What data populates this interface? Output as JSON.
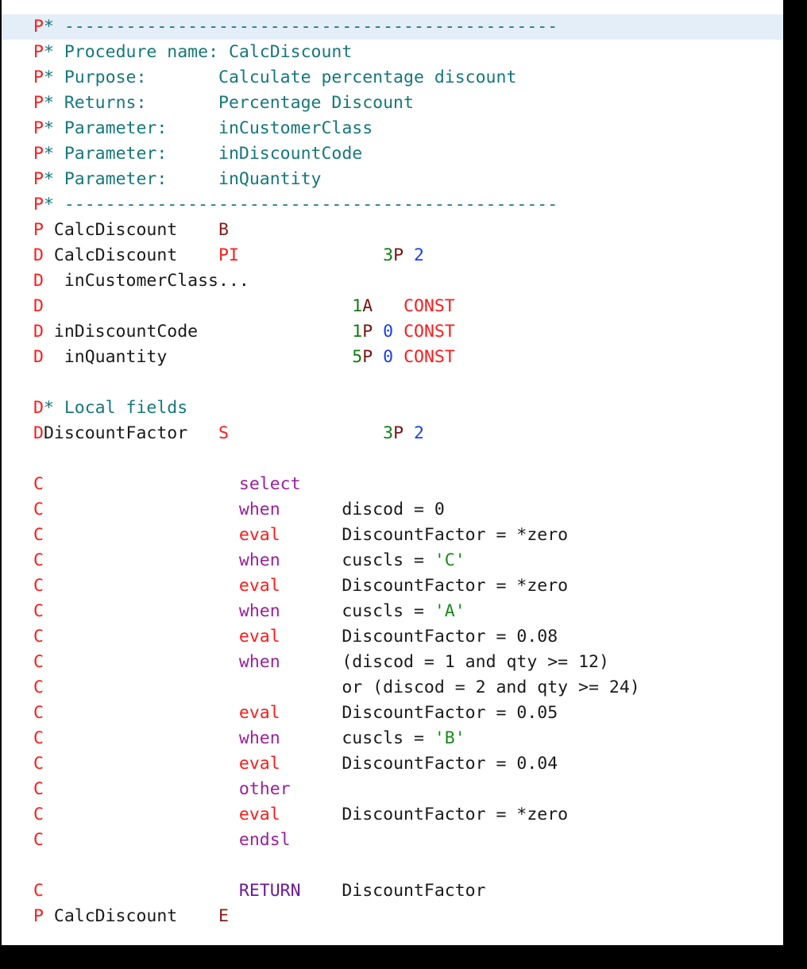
{
  "editor": {
    "language": "RPG IV / ILE RPG",
    "current_line_index": 0,
    "background_color": "#ffffff",
    "current_line_color": "#e4eef9",
    "frame_color": "#000000",
    "colors": {
      "spec_letter": "#ff1a1a",
      "spec_letter_dark": "#8b1a1a",
      "comment": "#15777b",
      "identifier": "#1a1a1a",
      "keyword_red": "#ff1a1a",
      "keyword_purple": "#9b1f9b",
      "keyword_return": "#6a1b9a",
      "length": "#127a12",
      "datatype": "#7a1414",
      "decimals": "#1a3ef0",
      "literal": "#1a8a1a"
    }
  },
  "source": {
    "procedure_name": "CalcDiscount",
    "lines": [
      {
        "id": "l01",
        "current": true,
        "tokens": [
          {
            "text": "P*",
            "cls": "t-spec-star"
          },
          {
            "text": " ------------------------------------------------",
            "cls": "t-comment"
          }
        ]
      },
      {
        "id": "l02",
        "tokens": [
          {
            "text": "P*",
            "cls": "t-spec-star"
          },
          {
            "text": " Procedure name: CalcDiscount",
            "cls": "t-comment"
          }
        ]
      },
      {
        "id": "l03",
        "tokens": [
          {
            "text": "P*",
            "cls": "t-spec-star"
          },
          {
            "text": " Purpose:       Calculate percentage discount",
            "cls": "t-comment"
          }
        ]
      },
      {
        "id": "l04",
        "tokens": [
          {
            "text": "P*",
            "cls": "t-spec-star"
          },
          {
            "text": " Returns:       Percentage Discount",
            "cls": "t-comment"
          }
        ]
      },
      {
        "id": "l05",
        "tokens": [
          {
            "text": "P*",
            "cls": "t-spec-star"
          },
          {
            "text": " Parameter:     inCustomerClass",
            "cls": "t-comment"
          }
        ]
      },
      {
        "id": "l06",
        "tokens": [
          {
            "text": "P*",
            "cls": "t-spec-star"
          },
          {
            "text": " Parameter:     inDiscountCode",
            "cls": "t-comment"
          }
        ]
      },
      {
        "id": "l07",
        "tokens": [
          {
            "text": "P*",
            "cls": "t-spec-star"
          },
          {
            "text": " Parameter:     inQuantity",
            "cls": "t-comment"
          }
        ]
      },
      {
        "id": "l08",
        "tokens": [
          {
            "text": "P*",
            "cls": "t-spec-star"
          },
          {
            "text": " ------------------------------------------------",
            "cls": "t-comment"
          }
        ]
      },
      {
        "id": "l09",
        "tokens": [
          {
            "text": "P",
            "cls": "t-spec"
          },
          {
            "text": " CalcDiscount",
            "cls": "t-name"
          },
          {
            "text": "    ",
            "cls": "t-name"
          },
          {
            "text": "B",
            "cls": "t-spec-dark"
          }
        ]
      },
      {
        "id": "l10",
        "tokens": [
          {
            "text": "D",
            "cls": "t-spec"
          },
          {
            "text": " CalcDiscount",
            "cls": "t-name"
          },
          {
            "text": "    ",
            "cls": "t-name"
          },
          {
            "text": "PI",
            "cls": "t-kw-red"
          },
          {
            "text": "              ",
            "cls": "t-name"
          },
          {
            "text": "3",
            "cls": "t-len"
          },
          {
            "text": "P",
            "cls": "t-type"
          },
          {
            "text": " ",
            "cls": "t-name"
          },
          {
            "text": "2",
            "cls": "t-dec"
          }
        ]
      },
      {
        "id": "l11",
        "tokens": [
          {
            "text": "D",
            "cls": "t-spec"
          },
          {
            "text": "  inCustomerClass...",
            "cls": "t-name"
          }
        ]
      },
      {
        "id": "l12",
        "tokens": [
          {
            "text": "D",
            "cls": "t-spec"
          },
          {
            "text": "                              ",
            "cls": "t-name"
          },
          {
            "text": "1",
            "cls": "t-len"
          },
          {
            "text": "A",
            "cls": "t-type"
          },
          {
            "text": "   ",
            "cls": "t-name"
          },
          {
            "text": "CONST",
            "cls": "t-kw-red"
          }
        ]
      },
      {
        "id": "l13",
        "tokens": [
          {
            "text": "D",
            "cls": "t-spec"
          },
          {
            "text": " inDiscountCode",
            "cls": "t-name"
          },
          {
            "text": "               ",
            "cls": "t-name"
          },
          {
            "text": "1",
            "cls": "t-len"
          },
          {
            "text": "P",
            "cls": "t-type"
          },
          {
            "text": " ",
            "cls": "t-name"
          },
          {
            "text": "0",
            "cls": "t-dec"
          },
          {
            "text": " ",
            "cls": "t-name"
          },
          {
            "text": "CONST",
            "cls": "t-kw-red"
          }
        ]
      },
      {
        "id": "l14",
        "tokens": [
          {
            "text": "D",
            "cls": "t-spec"
          },
          {
            "text": "  inQuantity",
            "cls": "t-name"
          },
          {
            "text": "                  ",
            "cls": "t-name"
          },
          {
            "text": "5",
            "cls": "t-len"
          },
          {
            "text": "P",
            "cls": "t-type"
          },
          {
            "text": " ",
            "cls": "t-name"
          },
          {
            "text": "0",
            "cls": "t-dec"
          },
          {
            "text": " ",
            "cls": "t-name"
          },
          {
            "text": "CONST",
            "cls": "t-kw-red"
          }
        ]
      },
      {
        "id": "l15",
        "blank": true,
        "tokens": []
      },
      {
        "id": "l16",
        "tokens": [
          {
            "text": "D*",
            "cls": "t-spec-star"
          },
          {
            "text": " Local fields",
            "cls": "t-comment"
          }
        ]
      },
      {
        "id": "l17",
        "tokens": [
          {
            "text": "D",
            "cls": "t-spec"
          },
          {
            "text": "DiscountFactor",
            "cls": "t-name"
          },
          {
            "text": "   ",
            "cls": "t-name"
          },
          {
            "text": "S",
            "cls": "t-kw-red"
          },
          {
            "text": "               ",
            "cls": "t-name"
          },
          {
            "text": "3",
            "cls": "t-len"
          },
          {
            "text": "P",
            "cls": "t-type"
          },
          {
            "text": " ",
            "cls": "t-name"
          },
          {
            "text": "2",
            "cls": "t-dec"
          }
        ]
      },
      {
        "id": "l18",
        "blank": true,
        "tokens": []
      },
      {
        "id": "l19",
        "tokens": [
          {
            "text": "C",
            "cls": "t-spec"
          },
          {
            "text": "                   ",
            "cls": "t-name"
          },
          {
            "text": "select",
            "cls": "t-kw-purple"
          }
        ]
      },
      {
        "id": "l20",
        "tokens": [
          {
            "text": "C",
            "cls": "t-spec"
          },
          {
            "text": "                   ",
            "cls": "t-name"
          },
          {
            "text": "when",
            "cls": "t-kw-purple"
          },
          {
            "text": "      discod = 0",
            "cls": "t-name"
          }
        ]
      },
      {
        "id": "l21",
        "tokens": [
          {
            "text": "C",
            "cls": "t-spec"
          },
          {
            "text": "                   ",
            "cls": "t-name"
          },
          {
            "text": "eval",
            "cls": "t-kw-red"
          },
          {
            "text": "      DiscountFactor = *zero",
            "cls": "t-name"
          }
        ]
      },
      {
        "id": "l22",
        "tokens": [
          {
            "text": "C",
            "cls": "t-spec"
          },
          {
            "text": "                   ",
            "cls": "t-name"
          },
          {
            "text": "when",
            "cls": "t-kw-purple"
          },
          {
            "text": "      cuscls = ",
            "cls": "t-name"
          },
          {
            "text": "'C'",
            "cls": "t-lit"
          }
        ]
      },
      {
        "id": "l23",
        "tokens": [
          {
            "text": "C",
            "cls": "t-spec"
          },
          {
            "text": "                   ",
            "cls": "t-name"
          },
          {
            "text": "eval",
            "cls": "t-kw-red"
          },
          {
            "text": "      DiscountFactor = *zero",
            "cls": "t-name"
          }
        ]
      },
      {
        "id": "l24",
        "tokens": [
          {
            "text": "C",
            "cls": "t-spec"
          },
          {
            "text": "                   ",
            "cls": "t-name"
          },
          {
            "text": "when",
            "cls": "t-kw-purple"
          },
          {
            "text": "      cuscls = ",
            "cls": "t-name"
          },
          {
            "text": "'A'",
            "cls": "t-lit"
          }
        ]
      },
      {
        "id": "l25",
        "tokens": [
          {
            "text": "C",
            "cls": "t-spec"
          },
          {
            "text": "                   ",
            "cls": "t-name"
          },
          {
            "text": "eval",
            "cls": "t-kw-red"
          },
          {
            "text": "      DiscountFactor = 0.08",
            "cls": "t-name"
          }
        ]
      },
      {
        "id": "l26",
        "tokens": [
          {
            "text": "C",
            "cls": "t-spec"
          },
          {
            "text": "                   ",
            "cls": "t-name"
          },
          {
            "text": "when",
            "cls": "t-kw-purple"
          },
          {
            "text": "      (discod = 1 and qty >= 12)",
            "cls": "t-name"
          }
        ]
      },
      {
        "id": "l27",
        "tokens": [
          {
            "text": "C",
            "cls": "t-spec"
          },
          {
            "text": "                             or (discod = 2 and qty >= 24)",
            "cls": "t-name"
          }
        ]
      },
      {
        "id": "l28",
        "tokens": [
          {
            "text": "C",
            "cls": "t-spec"
          },
          {
            "text": "                   ",
            "cls": "t-name"
          },
          {
            "text": "eval",
            "cls": "t-kw-red"
          },
          {
            "text": "      DiscountFactor = 0.05",
            "cls": "t-name"
          }
        ]
      },
      {
        "id": "l29",
        "tokens": [
          {
            "text": "C",
            "cls": "t-spec"
          },
          {
            "text": "                   ",
            "cls": "t-name"
          },
          {
            "text": "when",
            "cls": "t-kw-purple"
          },
          {
            "text": "      cuscls = ",
            "cls": "t-name"
          },
          {
            "text": "'B'",
            "cls": "t-lit"
          }
        ]
      },
      {
        "id": "l30",
        "tokens": [
          {
            "text": "C",
            "cls": "t-spec"
          },
          {
            "text": "                   ",
            "cls": "t-name"
          },
          {
            "text": "eval",
            "cls": "t-kw-red"
          },
          {
            "text": "      DiscountFactor = 0.04",
            "cls": "t-name"
          }
        ]
      },
      {
        "id": "l31",
        "tokens": [
          {
            "text": "C",
            "cls": "t-spec"
          },
          {
            "text": "                   ",
            "cls": "t-name"
          },
          {
            "text": "other",
            "cls": "t-kw-purple"
          }
        ]
      },
      {
        "id": "l32",
        "tokens": [
          {
            "text": "C",
            "cls": "t-spec"
          },
          {
            "text": "                   ",
            "cls": "t-name"
          },
          {
            "text": "eval",
            "cls": "t-kw-red"
          },
          {
            "text": "      DiscountFactor = *zero",
            "cls": "t-name"
          }
        ]
      },
      {
        "id": "l33",
        "tokens": [
          {
            "text": "C",
            "cls": "t-spec"
          },
          {
            "text": "                   ",
            "cls": "t-name"
          },
          {
            "text": "endsl",
            "cls": "t-kw-purple"
          }
        ]
      },
      {
        "id": "l34",
        "blank": true,
        "tokens": []
      },
      {
        "id": "l35",
        "tokens": [
          {
            "text": "C",
            "cls": "t-spec"
          },
          {
            "text": "                   ",
            "cls": "t-name"
          },
          {
            "text": "RETURN",
            "cls": "t-kw-return"
          },
          {
            "text": "    DiscountFactor",
            "cls": "t-name"
          }
        ]
      },
      {
        "id": "l36",
        "tokens": [
          {
            "text": "P",
            "cls": "t-spec"
          },
          {
            "text": " CalcDiscount",
            "cls": "t-name"
          },
          {
            "text": "    ",
            "cls": "t-name"
          },
          {
            "text": "E",
            "cls": "t-spec-dark"
          }
        ]
      }
    ]
  }
}
